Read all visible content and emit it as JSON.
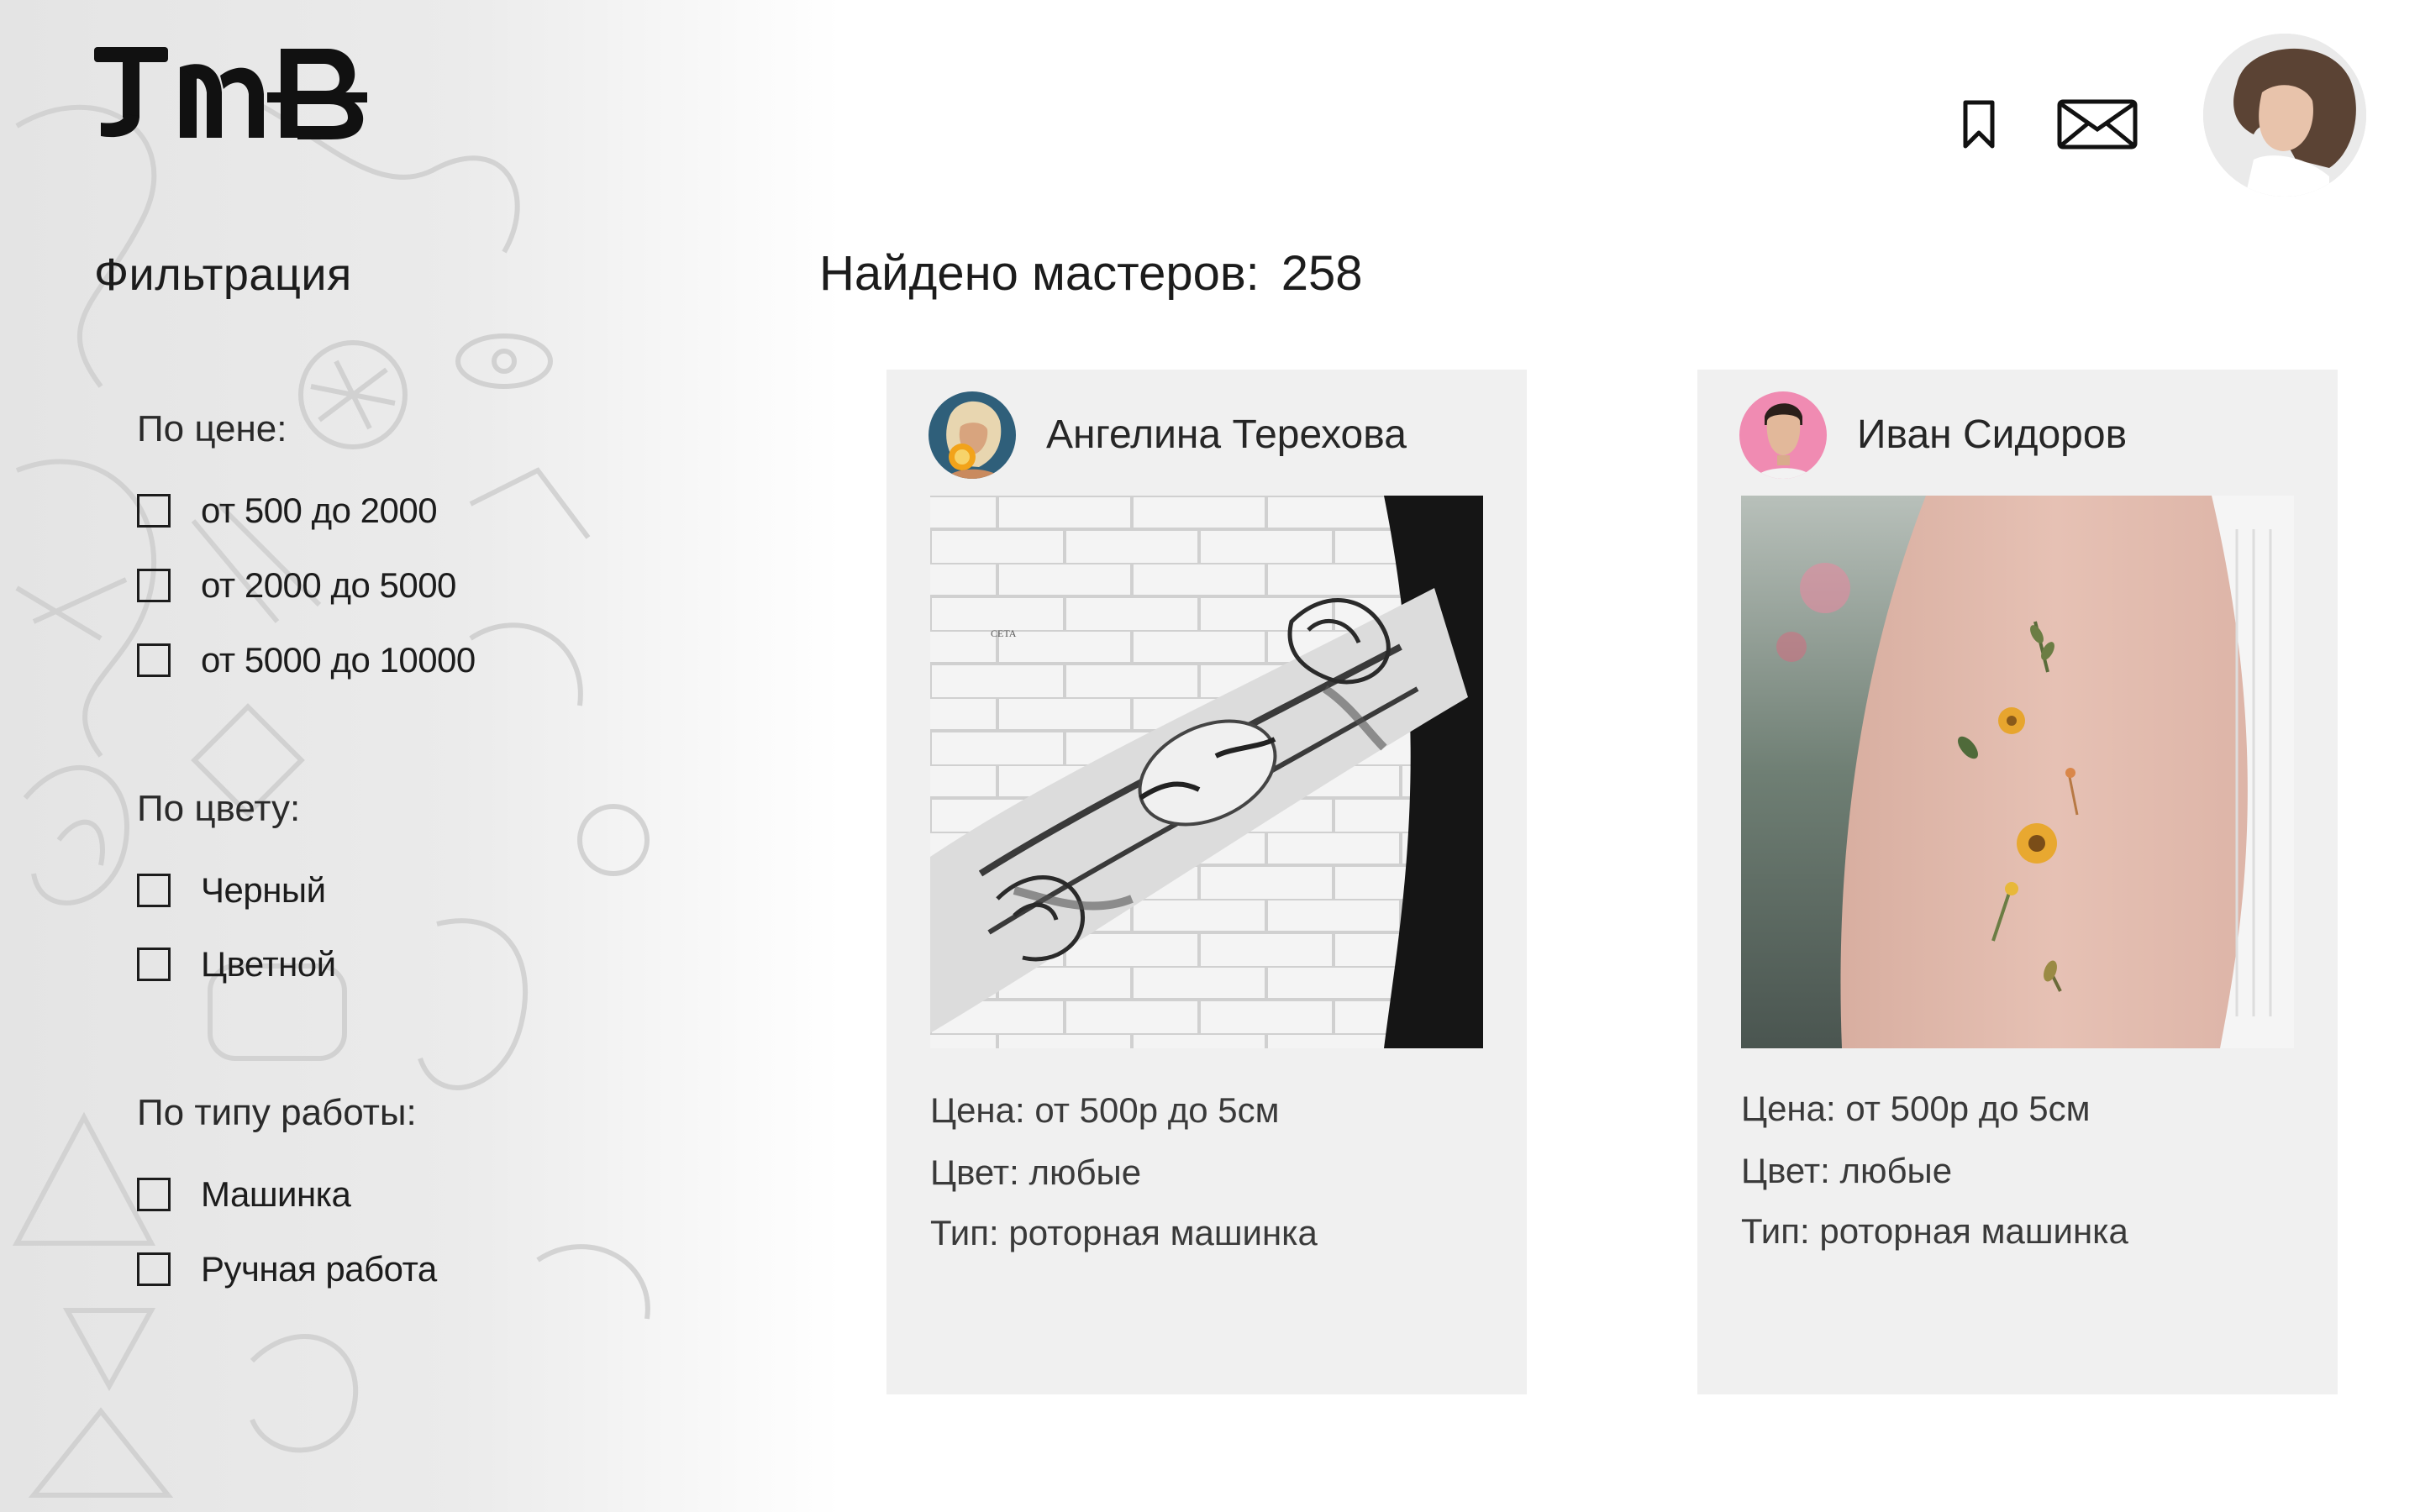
{
  "app": {
    "logo_text": "JMB"
  },
  "header": {
    "icons": [
      "bookmark-icon",
      "mail-icon"
    ],
    "user_avatar": "user-avatar"
  },
  "filters": {
    "title": "Фильтрация",
    "groups": [
      {
        "title": "По цене:",
        "options": [
          "от 500 до 2000",
          "от 2000 до 5000",
          "от 5000 до 10000"
        ]
      },
      {
        "title": "По цвету:",
        "options": [
          "Черный",
          "Цветной"
        ]
      },
      {
        "title": "По типу работы:",
        "options": [
          "Машинка",
          "Ручная работа"
        ]
      }
    ]
  },
  "results": {
    "label": "Найдено мастеров:",
    "count": "258"
  },
  "masters": [
    {
      "name": "Ангелина Терехова",
      "price": "Цена: от 500р до 5см",
      "color": "Цвет: любые",
      "type": "Тип: роторная машинка",
      "photo_watermark": "CETA"
    },
    {
      "name": "Иван Сидоров",
      "price": "Цена: от 500р до 5см",
      "color": "Цвет: любые",
      "type": "Тип: роторная машинка"
    }
  ],
  "colors": {
    "card_bg": "#f0f0f0",
    "text": "#1c1c1c",
    "muted_text": "#3a3a3a"
  }
}
